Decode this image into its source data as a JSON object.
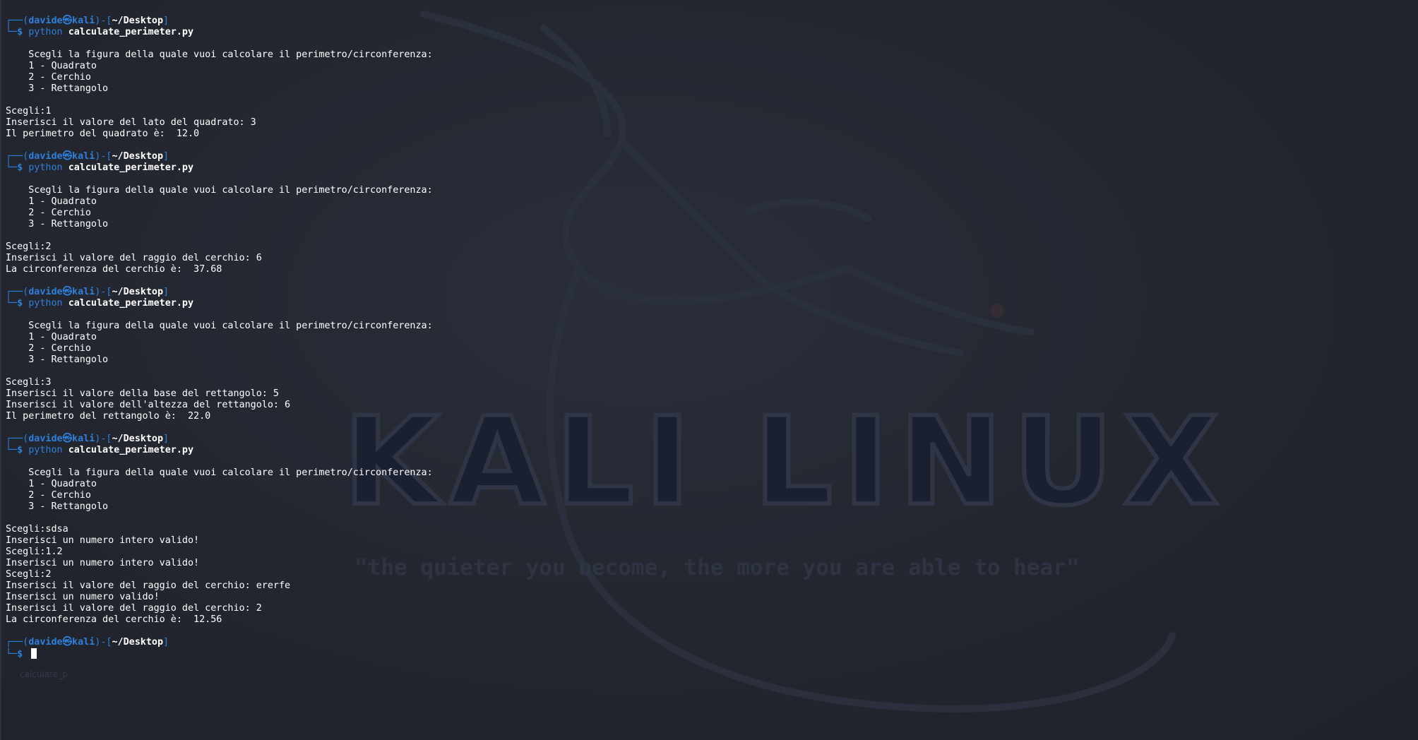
{
  "wallpaper": {
    "logo_text": "KALI LINUX",
    "quote": "\"the quieter you become, the more you are able to hear\"",
    "desktop_icon_label": "calculate_p"
  },
  "prompt": {
    "user": "davide",
    "host": "kali",
    "path": "~/Desktop",
    "at_symbol": "㉿"
  },
  "sessions": [
    {
      "command": "python",
      "argument": "calculate_perimeter.py",
      "output": [
        "",
        "    Scegli la figura della quale vuoi calcolare il perimetro/circonferenza:",
        "    1 - Quadrato",
        "    2 - Cerchio",
        "    3 - Rettangolo",
        "",
        "Scegli:1",
        "Inserisci il valore del lato del quadrato: 3",
        "Il perimetro del quadrato è:  12.0",
        ""
      ]
    },
    {
      "command": "python",
      "argument": "calculate_perimeter.py",
      "output": [
        "",
        "    Scegli la figura della quale vuoi calcolare il perimetro/circonferenza:",
        "    1 - Quadrato",
        "    2 - Cerchio",
        "    3 - Rettangolo",
        "",
        "Scegli:2",
        "Inserisci il valore del raggio del cerchio: 6",
        "La circonferenza del cerchio è:  37.68",
        ""
      ]
    },
    {
      "command": "python",
      "argument": "calculate_perimeter.py",
      "output": [
        "",
        "    Scegli la figura della quale vuoi calcolare il perimetro/circonferenza:",
        "    1 - Quadrato",
        "    2 - Cerchio",
        "    3 - Rettangolo",
        "",
        "Scegli:3",
        "Inserisci il valore della base del rettangolo: 5",
        "Inserisci il valore dell'altezza del rettangolo: 6",
        "Il perimetro del rettangolo è:  22.0",
        ""
      ]
    },
    {
      "command": "python",
      "argument": "calculate_perimeter.py",
      "output": [
        "",
        "    Scegli la figura della quale vuoi calcolare il perimetro/circonferenza:",
        "    1 - Quadrato",
        "    2 - Cerchio",
        "    3 - Rettangolo",
        "",
        "Scegli:sdsa",
        "Inserisci un numero intero valido!",
        "Scegli:1.2",
        "Inserisci un numero intero valido!",
        "Scegli:2",
        "Inserisci il valore del raggio del cerchio: ererfe",
        "Inserisci un numero valido!",
        "Inserisci il valore del raggio del cerchio: 2",
        "La circonferenza del cerchio è:  12.56",
        ""
      ]
    }
  ],
  "colors": {
    "background": "#23262f",
    "prompt_blue": "#2f7fdd",
    "text": "#ffffff"
  }
}
